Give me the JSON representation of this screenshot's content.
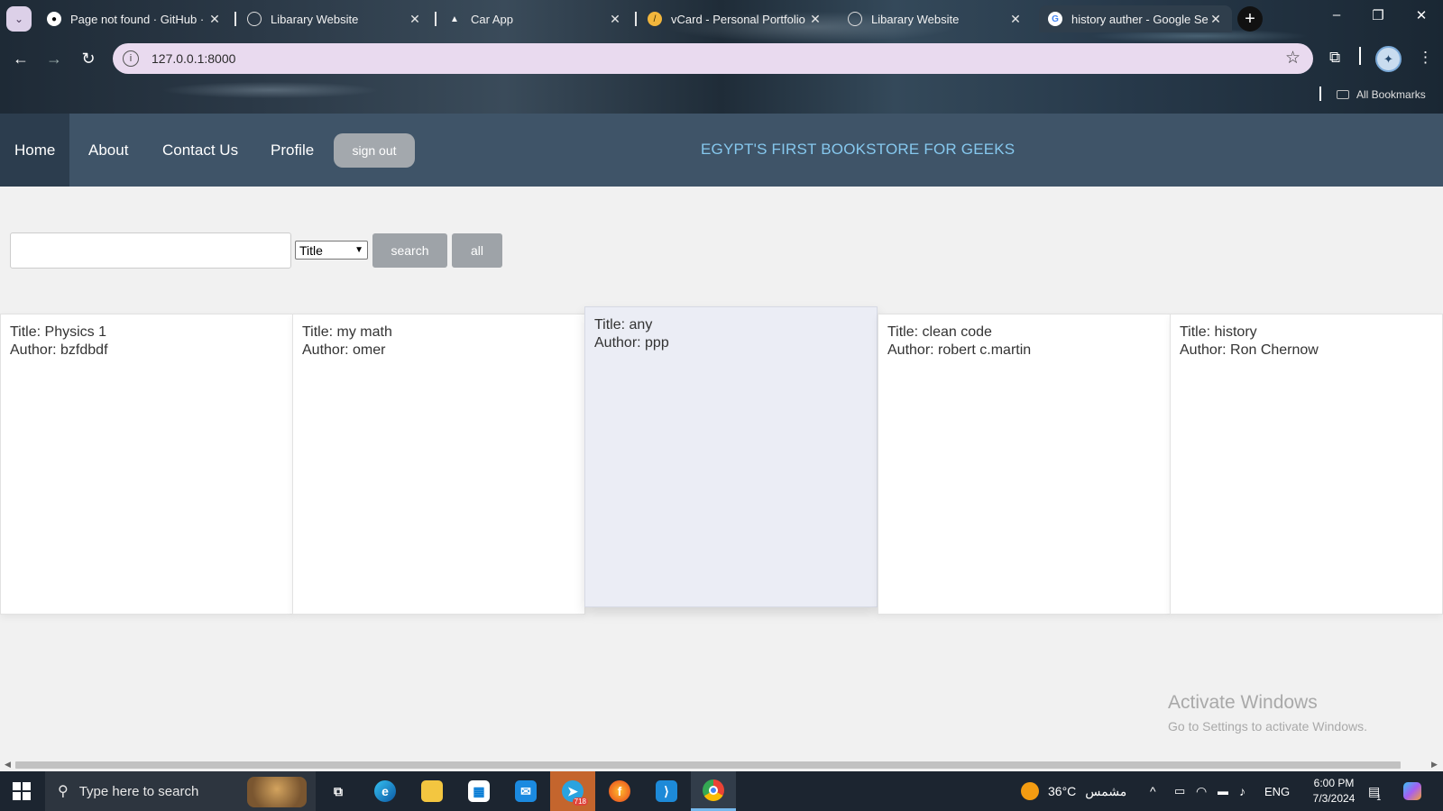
{
  "browser": {
    "tabs": [
      {
        "title": "Page not found · GitHub · C",
        "icon": "github-icon"
      },
      {
        "title": "Libarary Website",
        "icon": "globe-icon"
      },
      {
        "title": "Car App",
        "icon": "triangle-icon"
      },
      {
        "title": "vCard - Personal Portfolio",
        "icon": "vcard-icon"
      },
      {
        "title": "Libarary Website",
        "icon": "globe-icon"
      },
      {
        "title": "history auther - Google Se",
        "icon": "google-icon"
      }
    ],
    "url": "127.0.0.1:8000",
    "bookmarks_label": "All Bookmarks"
  },
  "nav": {
    "home": "Home",
    "about": "About",
    "contact": "Contact Us",
    "profile": "Profile",
    "signout": "sign out",
    "tagline": "EGYPT'S FIRST BOOKSTORE FOR GEEKS"
  },
  "search": {
    "input_value": "",
    "selected_field": "Title",
    "search_label": "search",
    "all_label": "all"
  },
  "books": [
    {
      "title": "Title: Physics 1",
      "author": "Author: bzfdbdf"
    },
    {
      "title": "Title: my math",
      "author": "Author: omer"
    },
    {
      "title": "Title: any",
      "author": "Author: ppp"
    },
    {
      "title": "Title: clean code",
      "author": "Author: robert c.martin"
    },
    {
      "title": "Title: history",
      "author": "Author: Ron Chernow"
    }
  ],
  "watermark": {
    "title": "Activate Windows",
    "subtitle": "Go to Settings to activate Windows."
  },
  "taskbar": {
    "search_placeholder": "Type here to search",
    "weather_temp": "36°C",
    "weather_text": "مشمس",
    "language": "ENG",
    "time": "6:00 PM",
    "date": "7/3/2024",
    "telegram_badge": "718",
    "notification_count": "1"
  }
}
